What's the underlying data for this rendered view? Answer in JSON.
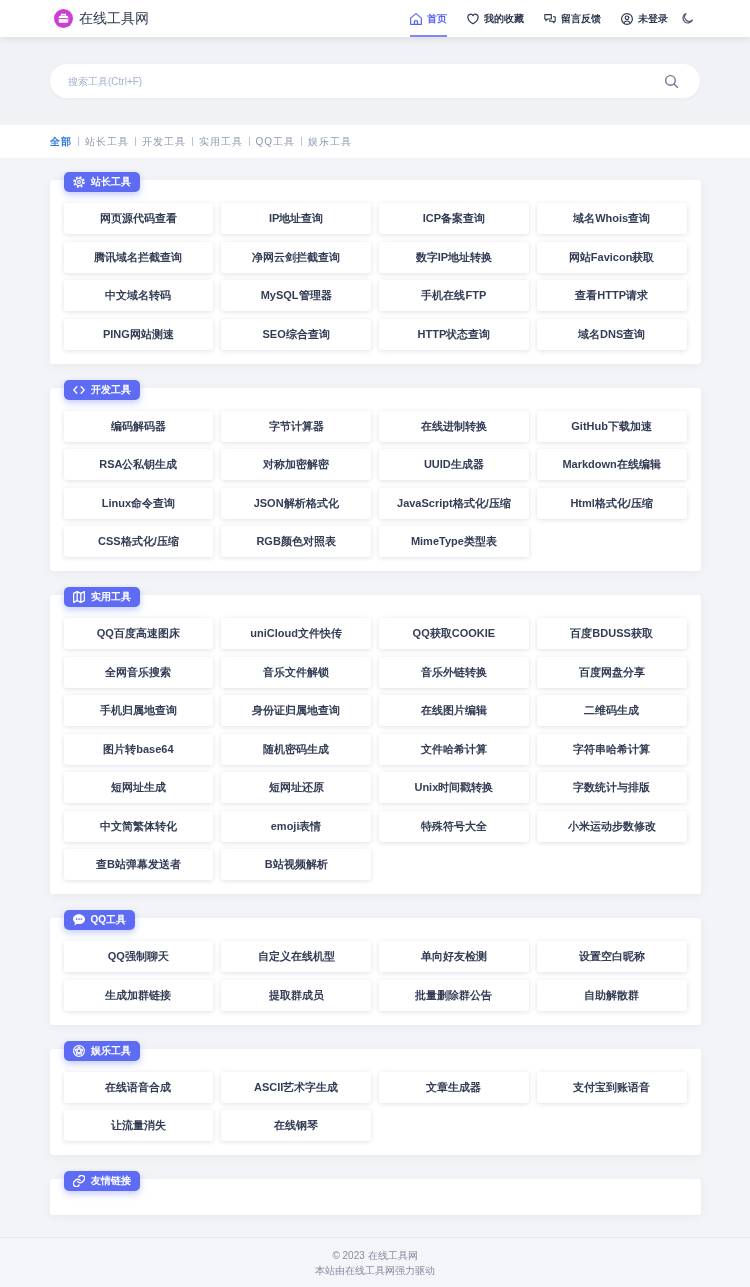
{
  "header": {
    "site_title": "在线工具网",
    "nav": [
      {
        "label": "首页",
        "selected": true
      },
      {
        "label": "我的收藏",
        "selected": false
      },
      {
        "label": "留言反馈",
        "selected": false
      },
      {
        "label": "未登录",
        "selected": false
      }
    ]
  },
  "search": {
    "placeholder": "搜索工具(Ctrl+F)"
  },
  "categories": [
    {
      "label": "全部",
      "selected": true
    },
    {
      "label": "站长工具",
      "selected": false
    },
    {
      "label": "开发工具",
      "selected": false
    },
    {
      "label": "实用工具",
      "selected": false
    },
    {
      "label": "QQ工具",
      "selected": false
    },
    {
      "label": "娱乐工具",
      "selected": false
    }
  ],
  "sections": [
    {
      "title": "站长工具",
      "tools": [
        "网页源代码查看",
        "IP地址查询",
        "ICP备案查询",
        "域名Whois查询",
        "腾讯域名拦截查询",
        "净网云剑拦截查询",
        "数字IP地址转换",
        "网站Favicon获取",
        "中文域名转码",
        "MySQL管理器",
        "手机在线FTP",
        "查看HTTP请求",
        "PING网站测速",
        "SEO综合查询",
        "HTTP状态查询",
        "域名DNS查询"
      ]
    },
    {
      "title": "开发工具",
      "tools": [
        "编码解码器",
        "字节计算器",
        "在线进制转换",
        "GitHub下载加速",
        "RSA公私钥生成",
        "对称加密解密",
        "UUID生成器",
        "Markdown在线编辑",
        "Linux命令查询",
        "JSON解析格式化",
        "JavaScript格式化/压缩",
        "Html格式化/压缩",
        "CSS格式化/压缩",
        "RGB颜色对照表",
        "MimeType类型表"
      ]
    },
    {
      "title": "实用工具",
      "tools": [
        "QQ百度高速图床",
        "uniCloud文件快传",
        "QQ获取COOKIE",
        "百度BDUSS获取",
        "全网音乐搜索",
        "音乐文件解锁",
        "音乐外链转换",
        "百度网盘分享",
        "手机归属地查询",
        "身份证归属地查询",
        "在线图片编辑",
        "二维码生成",
        "图片转base64",
        "随机密码生成",
        "文件哈希计算",
        "字符串哈希计算",
        "短网址生成",
        "短网址还原",
        "Unix时间戳转换",
        "字数统计与排版",
        "中文简繁体转化",
        "emoji表情",
        "特殊符号大全",
        "小米运动步数修改",
        "查B站弹幕发送者",
        "B站视频解析"
      ]
    },
    {
      "title": "QQ工具",
      "tools": [
        "QQ强制聊天",
        "自定义在线机型",
        "单向好友检测",
        "设置空白昵称",
        "生成加群链接",
        "提取群成员",
        "批量删除群公告",
        "自助解散群"
      ]
    },
    {
      "title": "娱乐工具",
      "tools": [
        "在线语音合成",
        "ASCII艺术字生成",
        "文章生成器",
        "支付宝到账语音",
        "让流量消失",
        "在线钢琴"
      ]
    },
    {
      "title": "友情链接"
    }
  ],
  "footer": {
    "copyright": "© 2023 在线工具网",
    "powered_by": "本站由在线工具网强力驱动"
  }
}
